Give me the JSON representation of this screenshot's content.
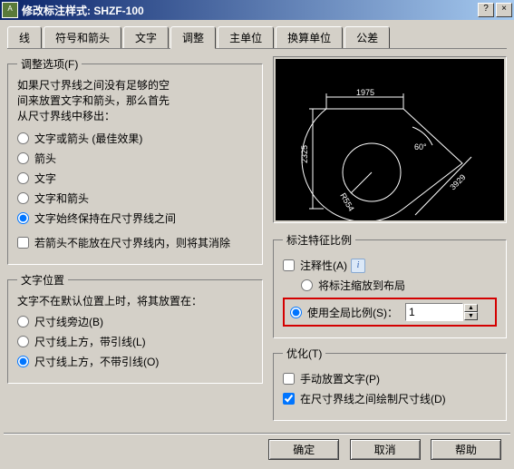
{
  "window": {
    "title": "修改标注样式: SHZF-100",
    "help_btn": "?",
    "close_btn": "×"
  },
  "tabs": [
    "线",
    "符号和箭头",
    "文字",
    "调整",
    "主单位",
    "换算单位",
    "公差"
  ],
  "active_tab": 3,
  "fit_options": {
    "legend": "调整选项(F)",
    "intro1": "如果尺寸界线之间没有足够的空",
    "intro2": "间来放置文字和箭头，那么首先",
    "intro3": "从尺寸界线中移出：",
    "radios": [
      {
        "label": "文字或箭头 (最佳效果)",
        "checked": false
      },
      {
        "label": "箭头",
        "checked": false
      },
      {
        "label": "文字",
        "checked": false
      },
      {
        "label": "文字和箭头",
        "checked": false
      },
      {
        "label": "文字始终保持在尺寸界线之间",
        "checked": true
      }
    ],
    "suppress": {
      "label": "若箭头不能放在尺寸界线内，则将其消除",
      "checked": false
    }
  },
  "text_place": {
    "legend": "文字位置",
    "intro": "文字不在默认位置上时，将其放置在：",
    "radios": [
      {
        "label": "尺寸线旁边(B)",
        "checked": false
      },
      {
        "label": "尺寸线上方，带引线(L)",
        "checked": false
      },
      {
        "label": "尺寸线上方，不带引线(O)",
        "checked": true
      }
    ]
  },
  "scale": {
    "legend": "标注特征比例",
    "annotative": {
      "label": "注释性(A)",
      "checked": false
    },
    "layout": {
      "label": "将标注缩放到布局",
      "checked": false
    },
    "global": {
      "label": "使用全局比例(S)：",
      "checked": true,
      "value": "1"
    }
  },
  "tuning": {
    "legend": "优化(T)",
    "manual": {
      "label": "手动放置文字(P)",
      "checked": false
    },
    "dimline": {
      "label": "在尺寸界线之间绘制尺寸线(D)",
      "checked": true
    }
  },
  "buttons": {
    "ok": "确定",
    "cancel": "取消",
    "help": "帮助"
  },
  "preview": {
    "dims": [
      "1975",
      "2325",
      "R554",
      "60°",
      "3929"
    ]
  }
}
